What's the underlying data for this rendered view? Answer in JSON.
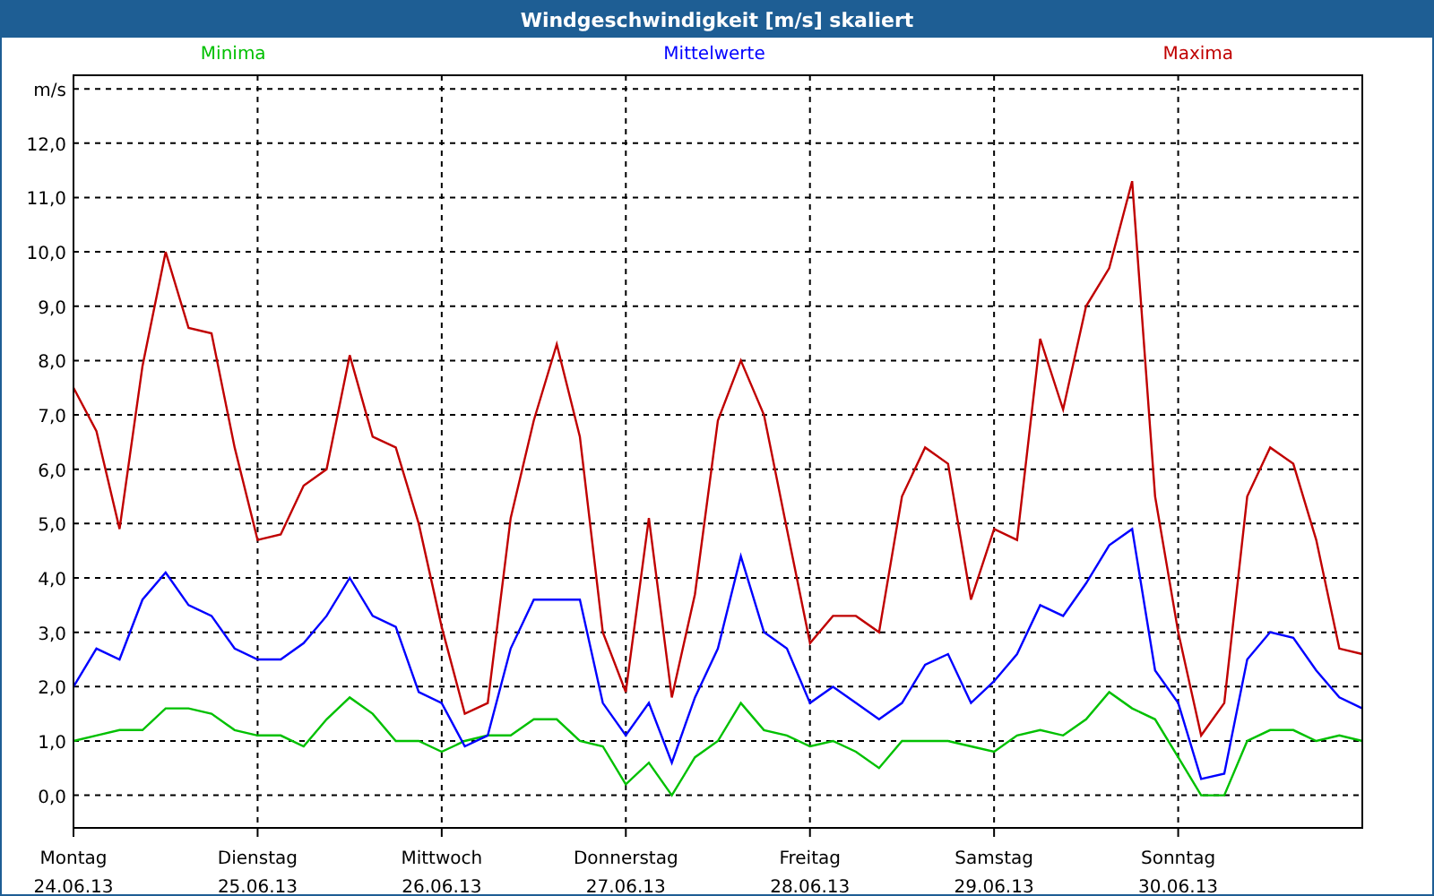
{
  "window": {
    "title": "Windgeschwindigkeit [m/s] skaliert"
  },
  "chart": {
    "chart_data": {
      "type": "line",
      "ylabel": "m/s",
      "ylim": [
        -0.6,
        13.25
      ],
      "grid": true,
      "categories": [
        "Montag",
        null,
        null,
        null,
        null,
        null,
        null,
        null,
        "Dienstag",
        null,
        null,
        null,
        null,
        null,
        null,
        null,
        "Mittwoch",
        null,
        null,
        null,
        null,
        null,
        null,
        null,
        "Donnerstag",
        null,
        null,
        null,
        null,
        null,
        null,
        null,
        "Freitag",
        null,
        null,
        null,
        null,
        null,
        null,
        null,
        "Samstag",
        null,
        null,
        null,
        null,
        null,
        null,
        null,
        "Sonntag",
        null,
        null,
        null,
        null,
        null,
        null,
        null,
        null
      ],
      "yticks": [
        {
          "value": 0,
          "label": "0,0"
        },
        {
          "value": 1,
          "label": "1,0"
        },
        {
          "value": 2,
          "label": "2,0"
        },
        {
          "value": 3,
          "label": "3,0"
        },
        {
          "value": 4,
          "label": "4,0"
        },
        {
          "value": 5,
          "label": "5,0"
        },
        {
          "value": 6,
          "label": "6,0"
        },
        {
          "value": 7,
          "label": "7,0"
        },
        {
          "value": 8,
          "label": "8,0"
        },
        {
          "value": 9,
          "label": "9,0"
        },
        {
          "value": 10,
          "label": "10,0"
        },
        {
          "value": 11,
          "label": "11,0"
        },
        {
          "value": 12,
          "label": "12,0"
        }
      ],
      "series": [
        {
          "name": "Minima",
          "color": "#00c000",
          "values": [
            1.0,
            1.1,
            1.2,
            1.2,
            1.6,
            1.6,
            1.5,
            1.2,
            1.1,
            1.1,
            0.9,
            1.4,
            1.8,
            1.5,
            1.0,
            1.0,
            0.8,
            1.0,
            1.1,
            1.1,
            1.4,
            1.4,
            1.0,
            0.9,
            0.2,
            0.6,
            0.0,
            0.7,
            1.0,
            1.7,
            1.2,
            1.1,
            0.9,
            1.0,
            0.8,
            0.5,
            1.0,
            1.0,
            1.0,
            0.9,
            0.8,
            1.1,
            1.2,
            1.1,
            1.4,
            1.9,
            1.6,
            1.4,
            0.7,
            0.0,
            0.0,
            1.0,
            1.2,
            1.2,
            1.0,
            1.1,
            1.0
          ]
        },
        {
          "name": "Mittelwerte",
          "color": "#0000ff",
          "values": [
            2.0,
            2.7,
            2.5,
            3.6,
            4.1,
            3.5,
            3.3,
            2.7,
            2.5,
            2.5,
            2.8,
            3.3,
            4.0,
            3.3,
            3.1,
            1.9,
            1.7,
            0.9,
            1.1,
            2.7,
            3.6,
            3.6,
            3.6,
            1.7,
            1.1,
            1.7,
            0.6,
            1.8,
            2.7,
            4.4,
            3.0,
            2.7,
            1.7,
            2.0,
            1.7,
            1.4,
            1.7,
            2.4,
            2.6,
            1.7,
            2.1,
            2.6,
            3.5,
            3.3,
            3.9,
            4.6,
            4.9,
            2.3,
            1.7,
            0.3,
            0.4,
            2.5,
            3.0,
            2.9,
            2.3,
            1.8,
            1.6
          ]
        },
        {
          "name": "Maxima",
          "color": "#c00000",
          "values": [
            7.5,
            6.7,
            4.9,
            7.9,
            10.0,
            8.6,
            8.5,
            6.4,
            4.7,
            4.8,
            5.7,
            6.0,
            8.1,
            6.6,
            6.4,
            5.0,
            3.1,
            1.5,
            1.7,
            5.1,
            6.9,
            8.3,
            6.6,
            3.0,
            1.9,
            5.1,
            1.8,
            3.7,
            6.9,
            8.0,
            7.0,
            4.9,
            2.8,
            3.3,
            3.3,
            3.0,
            5.5,
            6.4,
            6.1,
            3.6,
            4.9,
            4.7,
            8.4,
            7.1,
            9.0,
            9.7,
            11.3,
            5.5,
            3.0,
            1.1,
            1.7,
            5.5,
            6.4,
            6.1,
            4.7,
            2.7,
            2.6
          ]
        }
      ]
    },
    "x_tick_dates": [
      "24.06.13",
      "25.06.13",
      "26.06.13",
      "27.06.13",
      "28.06.13",
      "29.06.13",
      "30.06.13"
    ]
  }
}
